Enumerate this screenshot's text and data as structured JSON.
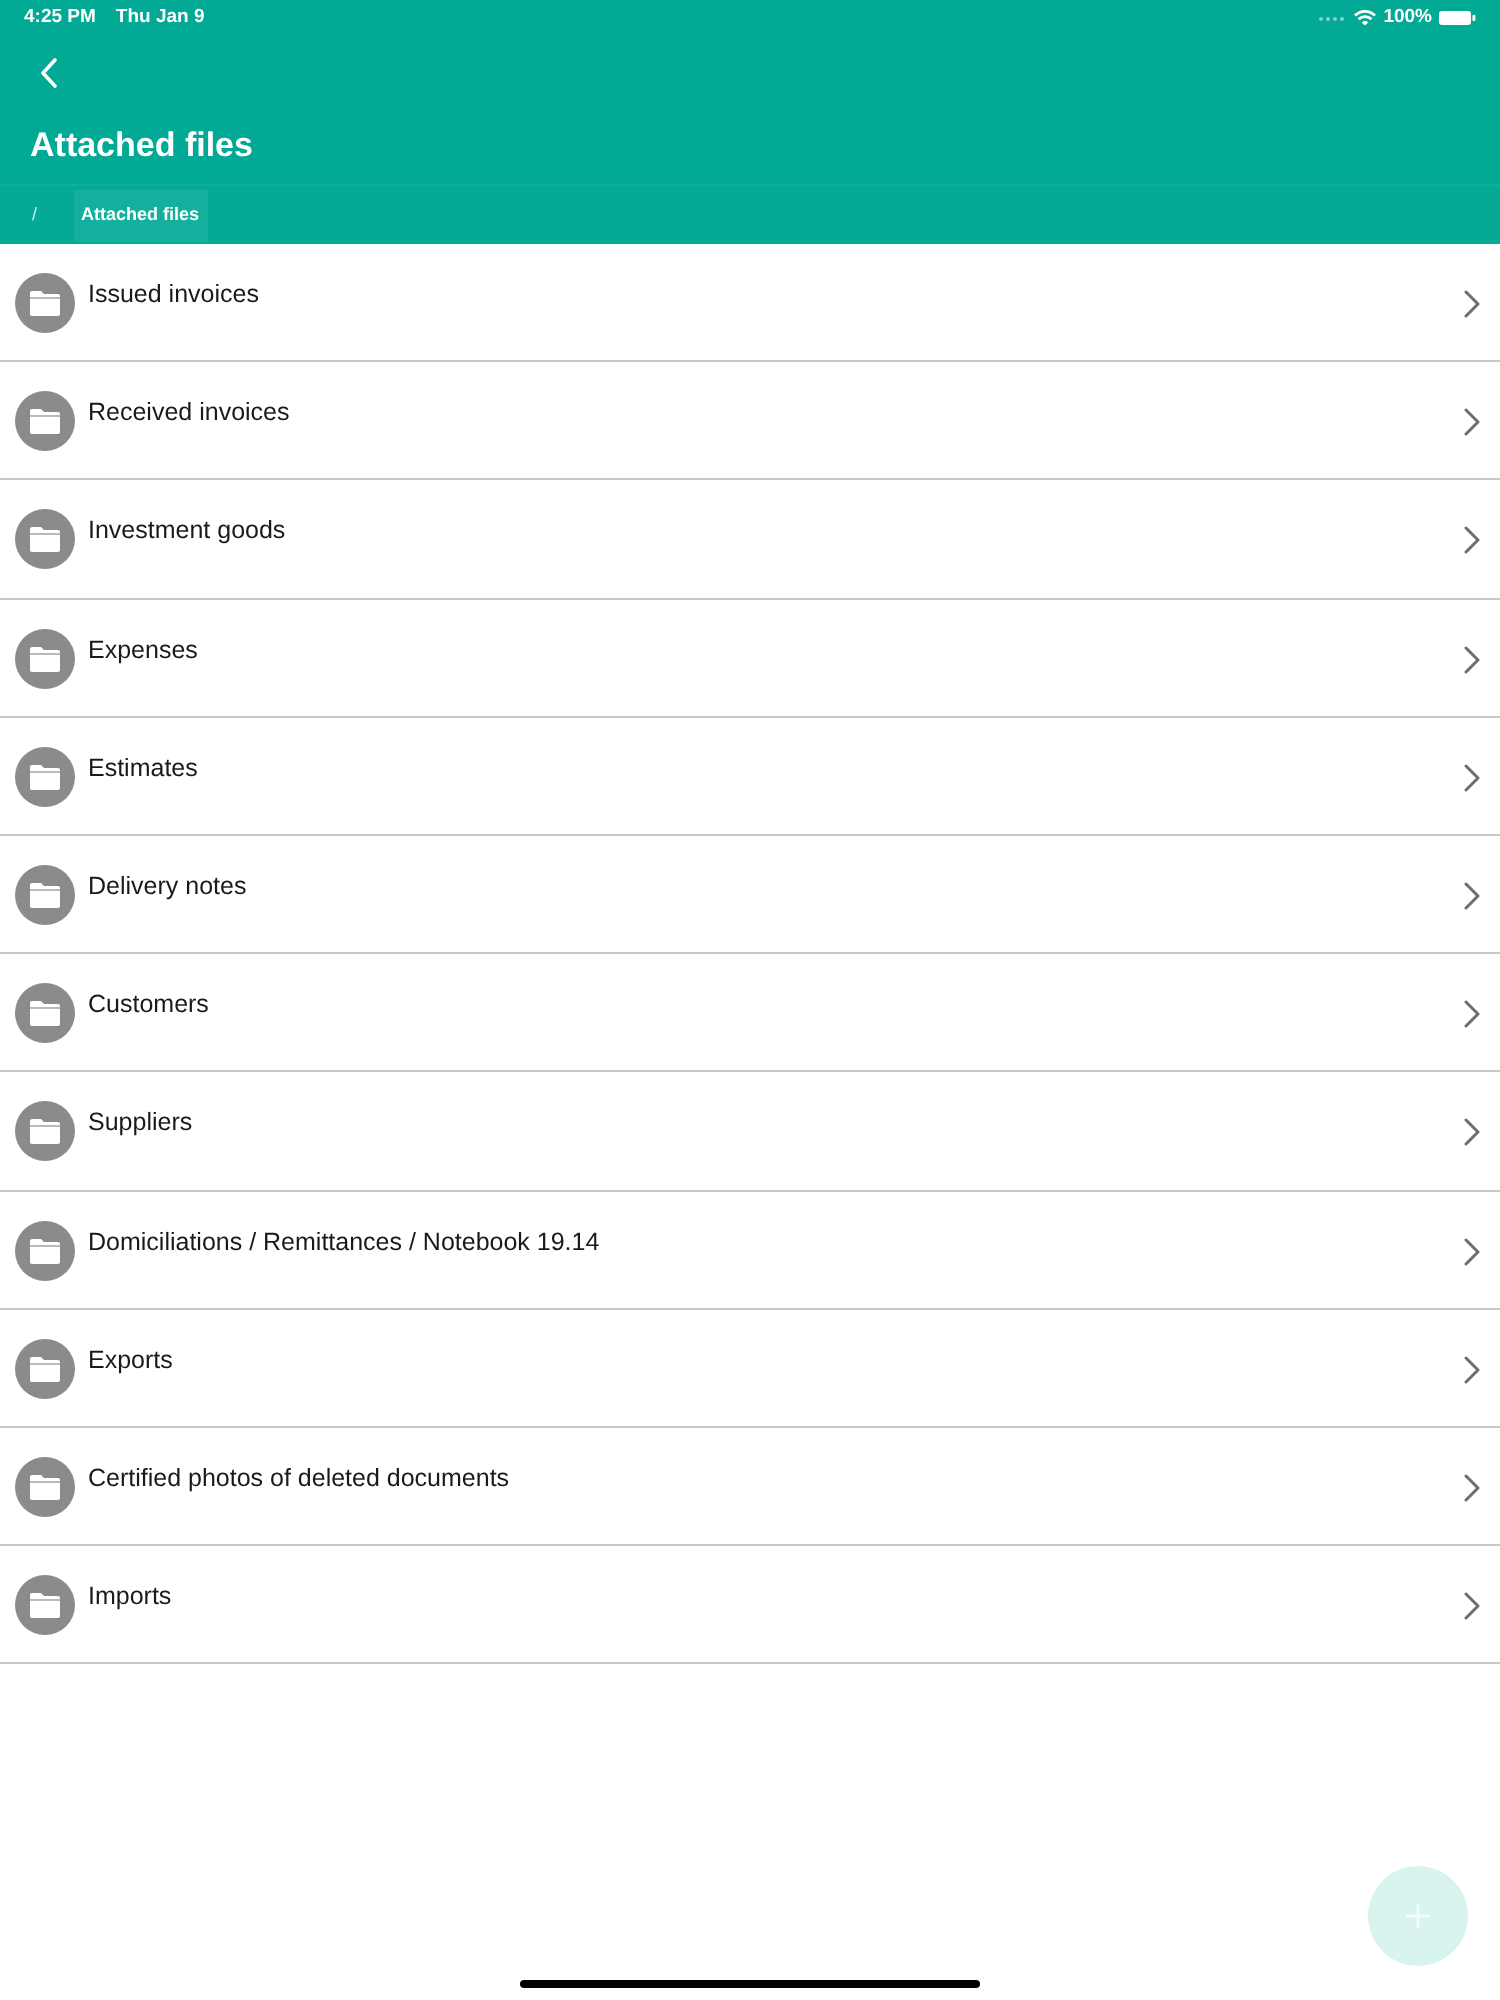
{
  "status_bar": {
    "time": "4:25 PM",
    "date": "Thu Jan 9",
    "battery": "100%"
  },
  "header": {
    "title": "Attached files",
    "breadcrumb": [
      {
        "label": "/",
        "selected": false
      },
      {
        "label": "Attached files",
        "selected": true
      }
    ]
  },
  "folders": [
    {
      "label": "Issued invoices"
    },
    {
      "label": "Received invoices"
    },
    {
      "label": "Investment goods"
    },
    {
      "label": "Expenses"
    },
    {
      "label": "Estimates"
    },
    {
      "label": "Delivery notes"
    },
    {
      "label": "Customers"
    },
    {
      "label": "Suppliers"
    },
    {
      "label": "Domiciliations / Remittances / Notebook 19.14"
    },
    {
      "label": "Exports"
    },
    {
      "label": "Certified photos of deleted documents"
    },
    {
      "label": "Imports"
    }
  ]
}
